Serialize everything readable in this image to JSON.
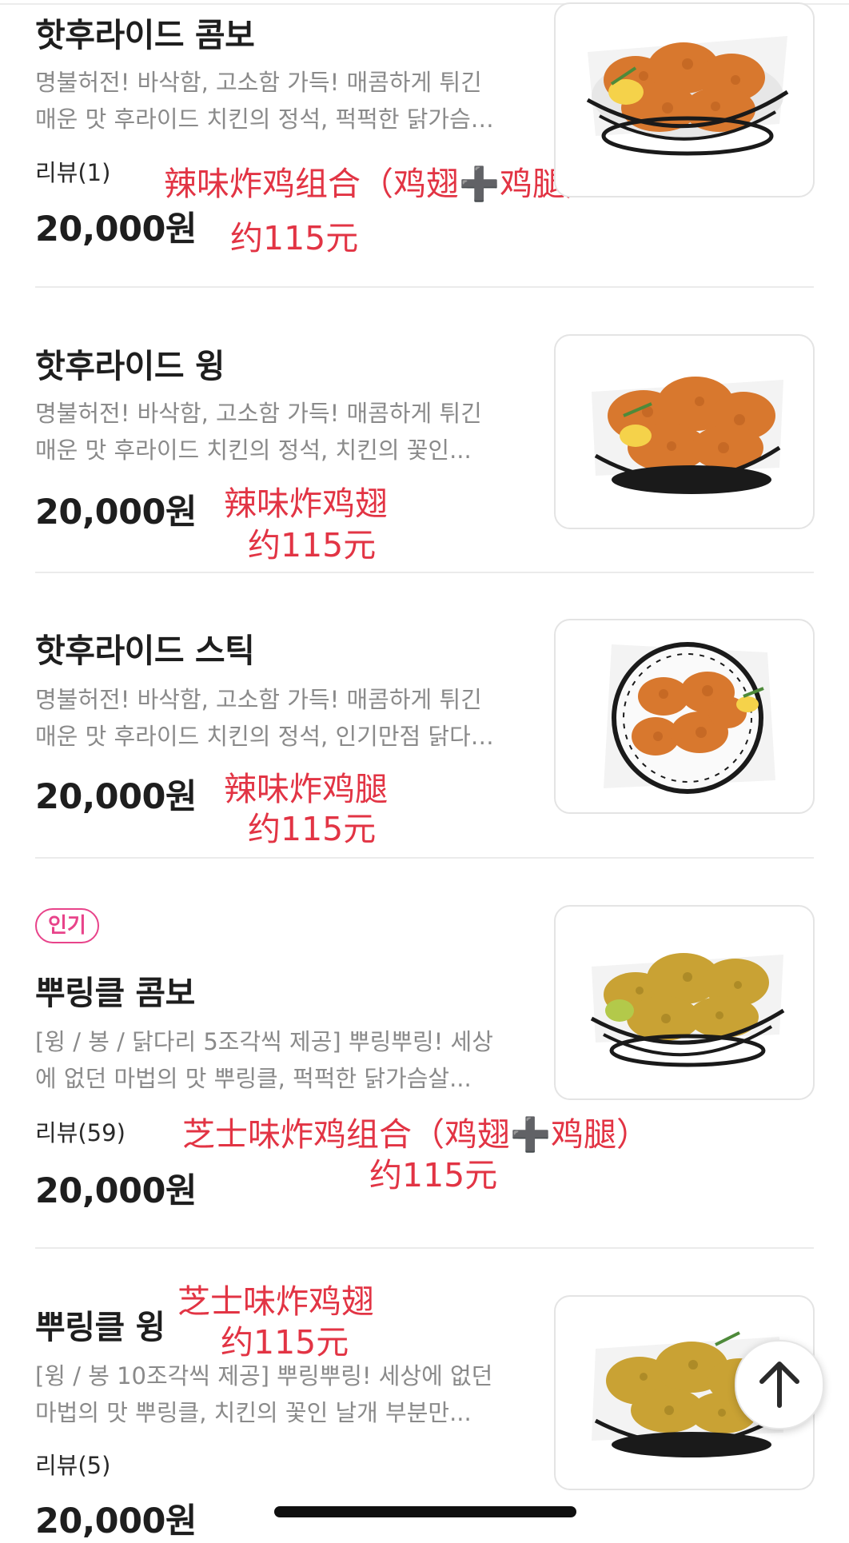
{
  "items": [
    {
      "name": "핫후라이드 콤보",
      "desc1": "명불허전! 바삭함, 고소함 가득! 매콤하게 튀긴",
      "desc2": "매운 맛 후라이드 치킨의 정석, 퍽퍽한 닭가슴…",
      "review": "리뷰(1)",
      "price": "20,000원",
      "anno_name": "辣味炸鸡组合（鸡翅➕鸡腿）",
      "anno_yuan": "约115元",
      "thumb_icon": "fried-chicken-basket-icon"
    },
    {
      "name": "핫후라이드 윙",
      "desc1": "명불허전! 바삭함, 고소함 가득! 매콤하게 튀긴",
      "desc2": "매운 맛 후라이드 치킨의 정석, 치킨의 꽃인...",
      "price": "20,000원",
      "anno_name": "辣味炸鸡翅",
      "anno_yuan": "约115元",
      "thumb_icon": "fried-chicken-wings-icon"
    },
    {
      "name": "핫후라이드 스틱",
      "desc1": "명불허전! 바삭함, 고소함 가득! 매콤하게 튀긴",
      "desc2": "매운 맛 후라이드 치킨의 정석, 인기만점 닭다…",
      "price": "20,000원",
      "anno_name": "辣味炸鸡腿",
      "anno_yuan": "约115元",
      "thumb_icon": "fried-chicken-drumsticks-icon"
    },
    {
      "badge": "인기",
      "name": "뿌링클 콤보",
      "desc1": "[윙 / 봉 / 닭다리 5조각씩 제공] 뿌링뿌링! 세상",
      "desc2": "에 없던 마법의 맛 뿌링클, 퍽퍽한 닭가슴살...",
      "review": "리뷰(59)",
      "price": "20,000원",
      "anno_name": "芝士味炸鸡组合（鸡翅➕鸡腿）",
      "anno_yuan": "约115元",
      "thumb_icon": "cheese-chicken-basket-icon"
    },
    {
      "name": "뿌링클 윙",
      "desc1": "[윙 / 봉 10조각씩 제공] 뿌링뿌링! 세상에 없던",
      "desc2": "마법의 맛 뿌링클, 치킨의 꽃인 날개 부분만...",
      "review": "리뷰(5)",
      "price": "20,000원",
      "anno_name": "芝士味炸鸡翅",
      "anno_yuan": "约115元",
      "thumb_icon": "cheese-chicken-wings-icon"
    }
  ],
  "scroll_top_icon": "arrow-up-icon",
  "colors": {
    "annotation": "#e23444",
    "badge": "#e8438a",
    "chicken_hot": "#d8782e",
    "chicken_cheese": "#c9a234"
  }
}
